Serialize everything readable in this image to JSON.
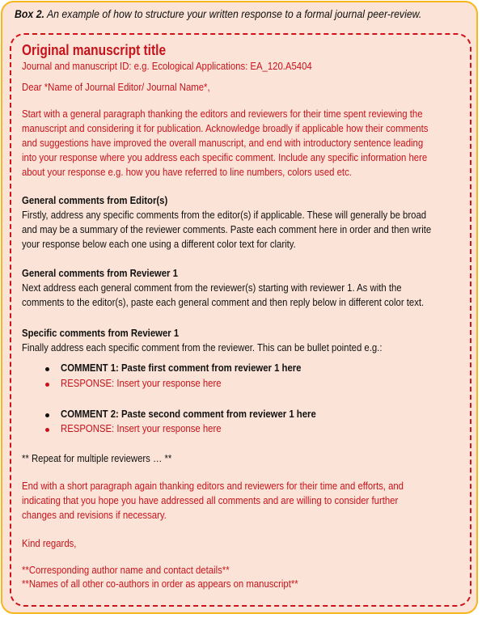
{
  "caption": {
    "label": "Box 2.",
    "text": " An example of how to structure your written response to a formal journal peer-review."
  },
  "title": "Original manuscript title",
  "journal_id": "Journal and manuscript ID: e.g. Ecological Applications: EA_120.A5404",
  "salutation": "Dear *Name of Journal Editor/ Journal Name*,",
  "intro": [
    "Start with a general paragraph thanking the editors and reviewers for their time spent reviewing the",
    "manuscript and considering it for publication. Acknowledge broadly if applicable how their comments",
    "and suggestions have improved the overall manuscript, and end with introductory sentence leading",
    "into your response where you address each specific comment. Include any specific information here",
    "about your response e.g. how you have referred to line numbers, colors used etc."
  ],
  "editor": {
    "heading": "General comments from Editor(s)",
    "lines": [
      "Firstly, address any specific comments from the editor(s) if applicable. These will generally be broad",
      "and may be a summary of the reviewer comments.  Paste each comment here in order and then write",
      "your response below each one using a different color text for clarity."
    ]
  },
  "reviewer_general": {
    "heading": "General comments from Reviewer 1",
    "lines": [
      "Next address each  general comment from the reviewer(s) starting with reviewer 1.  As with the",
      "comments to the editor(s), paste each general comment and then reply below in different color text."
    ]
  },
  "reviewer_specific": {
    "heading": "Specific comments from Reviewer 1",
    "lines": [
      "Finally address each specific comment from the reviewer. This can be bullet pointed e.g.:"
    ],
    "items": [
      {
        "comment": "COMMENT 1:  Paste first comment from reviewer 1 here",
        "response": "RESPONSE: Insert your response here"
      },
      {
        "comment": "COMMENT 2:  Paste second comment from reviewer 1 here",
        "response": "RESPONSE: Insert your response here"
      }
    ]
  },
  "repeat": "** Repeat for multiple reviewers … **",
  "closing": [
    "End with a short paragraph again thanking editors and reviewers for their time and efforts, and",
    "indicating that you hope you have addressed all comments and are willing to consider further",
    "changes and revisions if necessary."
  ],
  "signoff": "Kind regards,",
  "authors": [
    "**Corresponding author name and contact details**",
    "**Names of all other co-authors in order as appears on manuscript**"
  ],
  "colors": {
    "red": "#c8121b",
    "border": "#f4b81c",
    "background": "#fbe4d7"
  }
}
